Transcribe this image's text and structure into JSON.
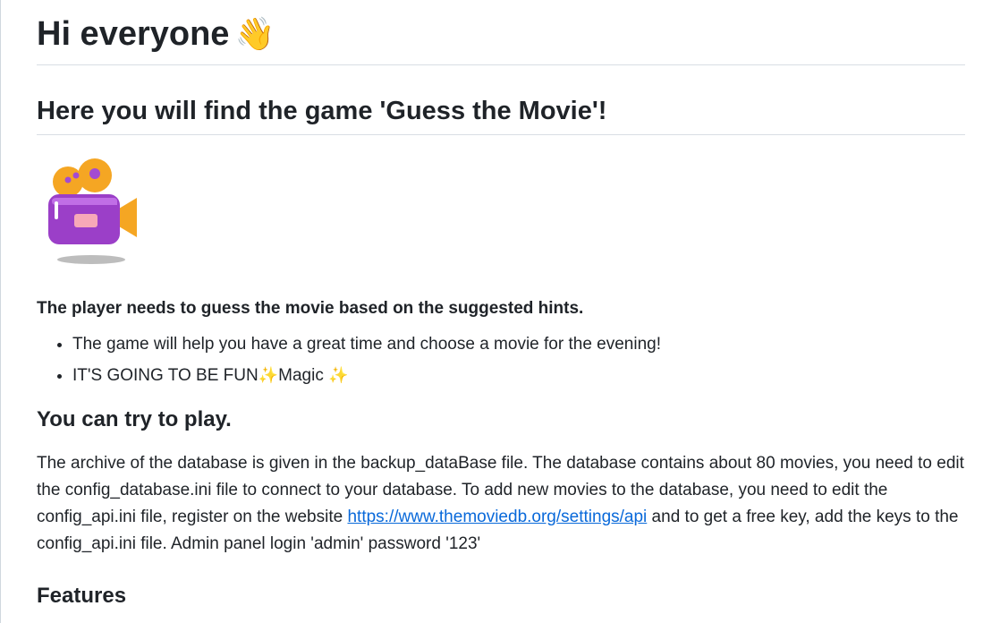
{
  "heading": {
    "title": "Hi everyone",
    "emoji": "👋"
  },
  "subheading": "Here you will find the game 'Guess the Movie'!",
  "logo": {
    "icon": "movie-camera-icon",
    "colors": {
      "body": "#9b3fc8",
      "reels": "#f5a623",
      "lens": "#f5a623",
      "shadow": "#bdbdbd"
    }
  },
  "intro": "The player needs to guess the movie based on the suggested hints.",
  "bullets": [
    {
      "text": "The game will help you have a great time and choose a movie for the evening!"
    },
    {
      "text_before": "IT'S GOING TO BE FUN",
      "sparkle1": "✨",
      "text_middle": "Magic ",
      "sparkle2": "✨"
    }
  ],
  "play_section": {
    "title": "You can try to play.",
    "text_before_link": "The archive of the database is given in the backup_dataBase file. The database contains about 80 movies, you need to edit the config_database.ini file to connect to your database. To add new movies to the database, you need to edit the config_api.ini file, register on the website ",
    "link": "https://www.themoviedb.org/settings/api",
    "text_after_link": " and to get a free key, add the keys to the config_api.ini file. Admin panel login 'admin' password '123'"
  },
  "features_title": "Features",
  "link_color": "#0969da"
}
